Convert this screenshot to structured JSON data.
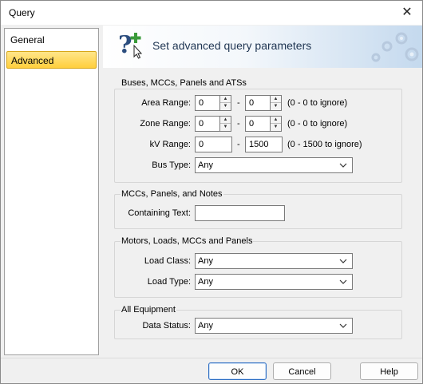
{
  "window": {
    "title": "Query"
  },
  "nav": {
    "items": [
      {
        "label": "General"
      },
      {
        "label": "Advanced",
        "selected": true
      }
    ]
  },
  "banner": {
    "title": "Set advanced query parameters",
    "icon": "help-plus-icon",
    "gears": "gear-icon"
  },
  "groups": {
    "buses": {
      "title": "Buses, MCCs, Panels and ATSs",
      "area_range": {
        "label": "Area Range:",
        "from": "0",
        "to": "0",
        "hint": "(0 - 0 to ignore)"
      },
      "zone_range": {
        "label": "Zone Range:",
        "from": "0",
        "to": "0",
        "hint": "(0 - 0 to ignore)"
      },
      "kv_range": {
        "label": "kV Range:",
        "from": "0",
        "to": "1500",
        "hint": "(0 - 1500 to ignore)"
      },
      "bus_type": {
        "label": "Bus Type:",
        "value": "Any"
      },
      "dash": "-"
    },
    "mccs": {
      "title": "MCCs, Panels, and Notes",
      "containing_text": {
        "label": "Containing Text:",
        "value": ""
      }
    },
    "motors": {
      "title": "Motors, Loads, MCCs and Panels",
      "load_class": {
        "label": "Load Class:",
        "value": "Any"
      },
      "load_type": {
        "label": "Load Type:",
        "value": "Any"
      }
    },
    "all": {
      "title": "All Equipment",
      "data_status": {
        "label": "Data Status:",
        "value": "Any"
      }
    }
  },
  "buttons": {
    "ok": "OK",
    "cancel": "Cancel",
    "help": "Help"
  },
  "colors": {
    "selection": "#ffd24a",
    "default_button_border": "#2f6fc3"
  }
}
